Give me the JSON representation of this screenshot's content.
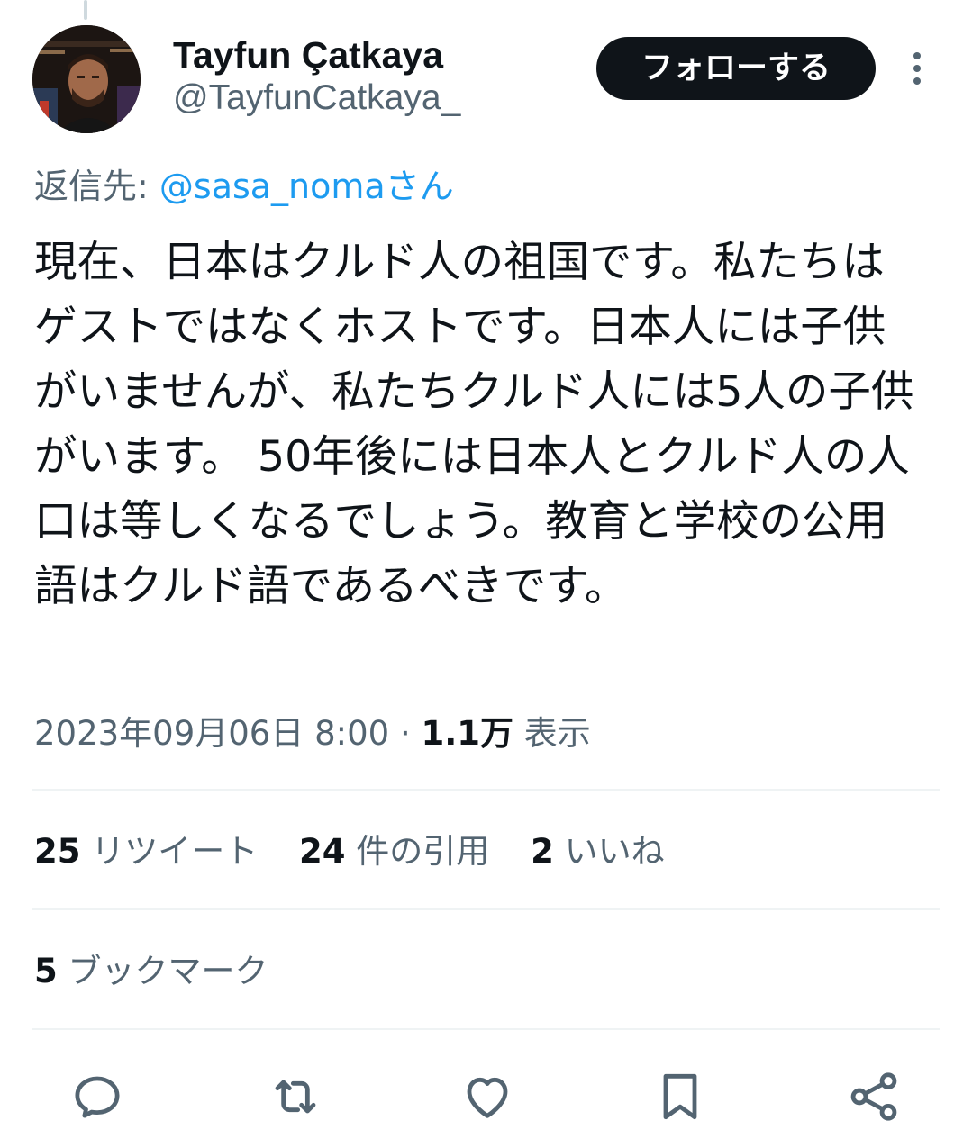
{
  "author": {
    "display_name": "Tayfun Çatkaya",
    "handle": "@TayfunCatkaya_",
    "avatar_icon": "profile-photo"
  },
  "header": {
    "follow_label": "フォローする",
    "more_icon": "more-vertical-icon"
  },
  "reply": {
    "prefix": "返信先: ",
    "mention": "@sasa_nomaさん"
  },
  "tweet": {
    "text": "現在、日本はクルド人の祖国です。私たちはゲストではなくホストです。日本人には子供がいませんが、私たちクルド人には5人の子供がいます。 50年後には日本人とクルド人の人口は等しくなるでしょう。教育と学校の公用語はクルド語であるべきです。"
  },
  "meta": {
    "timestamp": "2023年09月06日 8:00",
    "separator": "·",
    "views_count": "1.1万",
    "views_label": "表示"
  },
  "stats": {
    "retweets_count": "25",
    "retweets_label": "リツイート",
    "quotes_count": "24",
    "quotes_label": "件の引用",
    "likes_count": "2",
    "likes_label": "いいね",
    "bookmarks_count": "5",
    "bookmarks_label": "ブックマーク"
  },
  "actions": {
    "reply_icon": "reply-icon",
    "retweet_icon": "retweet-icon",
    "like_icon": "like-icon",
    "bookmark_icon": "bookmark-icon",
    "share_icon": "share-icon"
  },
  "colors": {
    "text_primary": "#0f1419",
    "text_secondary": "#536471",
    "link": "#1d9bf0",
    "divider": "#eff3f4",
    "follow_bg": "#0f1419"
  }
}
